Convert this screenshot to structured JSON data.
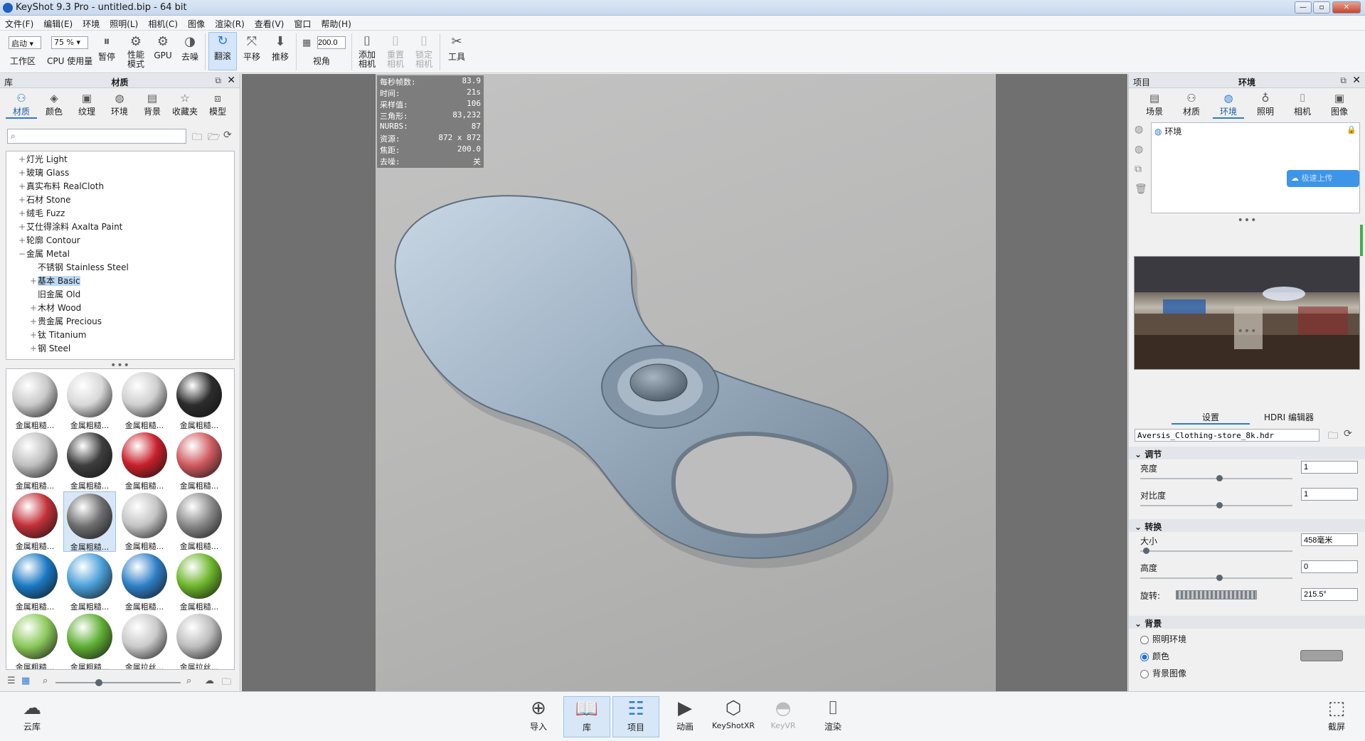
{
  "window": {
    "title": "KeyShot 9.3 Pro  - untitled.bip - 64 bit"
  },
  "menu": [
    "文件(F)",
    "编辑(E)",
    "环境",
    "照明(L)",
    "相机(C)",
    "图像",
    "渲染(R)",
    "查看(V)",
    "窗口",
    "帮助(H)"
  ],
  "toolbar": {
    "mode_value": "启动",
    "cpu_value": "75 %",
    "fov_value": "200.0",
    "workspace": "工作区",
    "cpu_usage": "CPU 使用量",
    "pause": "暂停",
    "perf_line1": "性能",
    "perf_line2": "模式",
    "gpu": "GPU",
    "denoise": "去噪",
    "tumble": "翻滚",
    "pan": "平移",
    "dolly": "推移",
    "fov": "视角",
    "add_camera_1": "添加",
    "add_camera_2": "相机",
    "reset_camera_1": "重置",
    "reset_camera_2": "相机",
    "lock_camera_1": "锁定",
    "lock_camera_2": "相机",
    "tools": "工具"
  },
  "library": {
    "header_left": "库",
    "title": "材质",
    "tabs": [
      {
        "label": "材质",
        "icon": "material-icon"
      },
      {
        "label": "颜色",
        "icon": "color-icon"
      },
      {
        "label": "纹理",
        "icon": "texture-icon"
      },
      {
        "label": "环境",
        "icon": "environment-icon"
      },
      {
        "label": "背景",
        "icon": "background-icon"
      },
      {
        "label": "收藏夹",
        "icon": "favorites-icon"
      },
      {
        "label": "模型",
        "icon": "model-icon"
      }
    ],
    "search_placeholder": "",
    "tree": [
      {
        "label": "灯光 Light",
        "pm": "+",
        "indent": 0
      },
      {
        "label": "玻璃 Glass",
        "pm": "+",
        "indent": 0
      },
      {
        "label": "真实布料 RealCloth",
        "pm": "+",
        "indent": 0
      },
      {
        "label": "石材 Stone",
        "pm": "+",
        "indent": 0
      },
      {
        "label": "绒毛 Fuzz",
        "pm": "+",
        "indent": 0
      },
      {
        "label": "艾仕得涂料 Axalta Paint",
        "pm": "+",
        "indent": 0
      },
      {
        "label": "轮廓 Contour",
        "pm": "+",
        "indent": 0
      },
      {
        "label": "金属 Metal",
        "pm": "−",
        "indent": 0
      },
      {
        "label": "不锈钢 Stainless Steel",
        "pm": "",
        "indent": 1
      },
      {
        "label": "基本 Basic",
        "pm": "+",
        "indent": 1,
        "selected": true
      },
      {
        "label": "旧金属 Old",
        "pm": "",
        "indent": 1
      },
      {
        "label": "木材 Wood",
        "pm": "+",
        "indent": 1
      },
      {
        "label": "贵金属 Precious",
        "pm": "+",
        "indent": 1
      },
      {
        "label": "钛 Titanium",
        "pm": "+",
        "indent": 1
      },
      {
        "label": "钢 Steel",
        "pm": "+",
        "indent": 1
      }
    ],
    "thumbnails": [
      {
        "caption": "金属粗糙...",
        "color": "#c9c9c9"
      },
      {
        "caption": "金属粗糙...",
        "color": "#d8d8d8"
      },
      {
        "caption": "金属粗糙...",
        "color": "#cfcfcf"
      },
      {
        "caption": "金属粗糙...",
        "color": "#2c2c2c"
      },
      {
        "caption": "金属粗糙...",
        "color": "#bfbfbf"
      },
      {
        "caption": "金属粗糙...",
        "color": "#3e3e3e"
      },
      {
        "caption": "金属粗糙...",
        "color": "#c8202a"
      },
      {
        "caption": "金属粗糙...",
        "color": "#cf5a5e"
      },
      {
        "caption": "金属粗糙...",
        "color": "#c23038"
      },
      {
        "caption": "金属粗糙...",
        "color": "#6e6e6e",
        "selected": true
      },
      {
        "caption": "金属粗糙...",
        "color": "#c4c4c4"
      },
      {
        "caption": "金属粗糙...",
        "color": "#8a8a8a"
      },
      {
        "caption": "金属粗糙...",
        "color": "#1a78c2"
      },
      {
        "caption": "金属粗糙...",
        "color": "#4a9fd8"
      },
      {
        "caption": "金属粗糙...",
        "color": "#2e7fc6"
      },
      {
        "caption": "金属粗糙...",
        "color": "#6cb52a"
      },
      {
        "caption": "金属粗糙...",
        "color": "#8bc85a"
      },
      {
        "caption": "金属粗糙...",
        "color": "#5fae34"
      },
      {
        "caption": "金属拉丝...",
        "color": "#cacaca"
      },
      {
        "caption": "金属拉丝...",
        "color": "#bdbdbd"
      }
    ]
  },
  "stats": [
    {
      "k": "每秒帧数:",
      "v": "83.9"
    },
    {
      "k": "时间:",
      "v": "21s"
    },
    {
      "k": "采样值:",
      "v": "106"
    },
    {
      "k": "三角形:",
      "v": "83,232"
    },
    {
      "k": "NURBS:",
      "v": "87"
    },
    {
      "k": "资源:",
      "v": "872 x 872"
    },
    {
      "k": "焦距:",
      "v": "200.0"
    },
    {
      "k": "去噪:",
      "v": "关"
    }
  ],
  "project": {
    "header_left": "项目",
    "title": "环境",
    "tabs": [
      {
        "label": "场景",
        "icon": "scene-icon"
      },
      {
        "label": "材质",
        "icon": "material-icon"
      },
      {
        "label": "环境",
        "icon": "environment-icon"
      },
      {
        "label": "照明",
        "icon": "lighting-icon"
      },
      {
        "label": "相机",
        "icon": "camera-icon"
      },
      {
        "label": "图像",
        "icon": "image-icon"
      }
    ],
    "env_item": "环境",
    "overlay_button": "极速上传",
    "subtabs": [
      "设置",
      "HDRI 编辑器"
    ],
    "hdr_file": "Aversis_Clothing-store_8k.hdr",
    "adjust": {
      "section": "调节",
      "brightness_label": "亮度",
      "brightness": "1",
      "brightness_frac": 0.52,
      "contrast_label": "对比度",
      "contrast": "1",
      "contrast_frac": 0.52
    },
    "transform": {
      "section": "转换",
      "size_label": "大小",
      "size": "458毫米",
      "size_frac": 0.02,
      "height_label": "高度",
      "height": "0",
      "height_frac": 0.52,
      "rotation_label": "旋转:",
      "rotation": "215.5°"
    },
    "background": {
      "section": "背景",
      "opt1": "照明环境",
      "opt2": "颜色",
      "opt3": "背景图像",
      "color": "#a0a0a0"
    }
  },
  "bottom": {
    "cloud": "云库",
    "import": "导入",
    "library": "库",
    "project": "项目",
    "animation": "动画",
    "keyshotxr": "KeyShotXR",
    "keyvr": "KeyVR",
    "render": "渲染",
    "screenshot": "截屏"
  }
}
